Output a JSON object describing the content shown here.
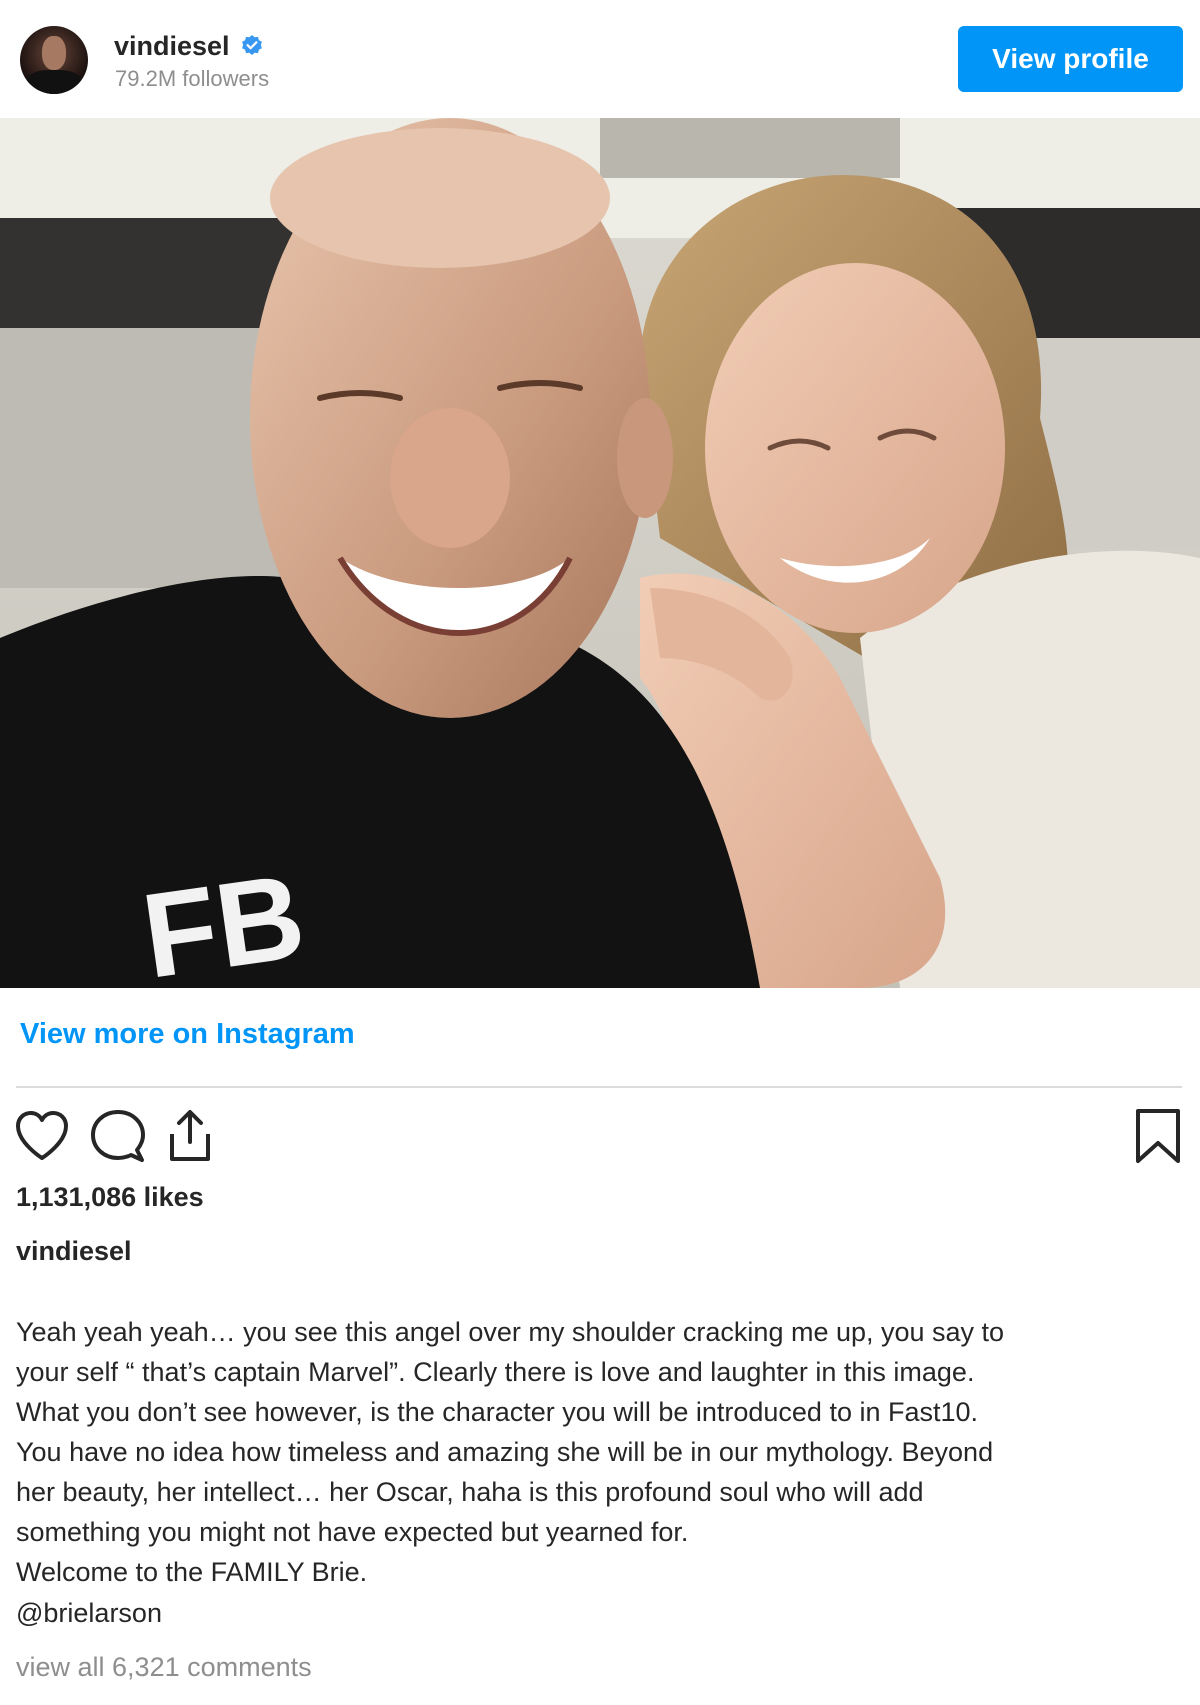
{
  "header": {
    "username": "vindiesel",
    "verified_icon": "verified-badge-icon",
    "followers": "79.2M followers",
    "view_profile_label": "View profile"
  },
  "post": {
    "photo_alt": "Selfie of two people laughing",
    "shirt_print": "FB",
    "view_more_label": "View more on Instagram",
    "likes": "1,131,086 likes",
    "caption_user": "vindiesel",
    "caption_lines": [
      "Yeah yeah yeah… you see this angel over my shoulder cracking me up, you say to",
      "your self “ that’s captain Marvel”. Clearly there is love and laughter in this image.",
      "What you don’t see however, is the character you will be introduced to in Fast10.",
      "You have no idea how timeless and amazing she will be in our mythology. Beyond",
      "her beauty, her intellect… her Oscar, haha is this profound soul who will add",
      "something you might not have expected but yearned for.",
      "Welcome to the FAMILY Brie."
    ],
    "mention": "@brielarson",
    "comments_label": "view all 6,321 comments"
  },
  "icons": {
    "like": "heart-icon",
    "comment": "comment-bubble-icon",
    "share": "share-icon",
    "save": "bookmark-icon"
  },
  "colors": {
    "accent": "#0095f6",
    "text": "#262626",
    "muted": "#8e8e8e",
    "divider": "#dbdbdb"
  }
}
